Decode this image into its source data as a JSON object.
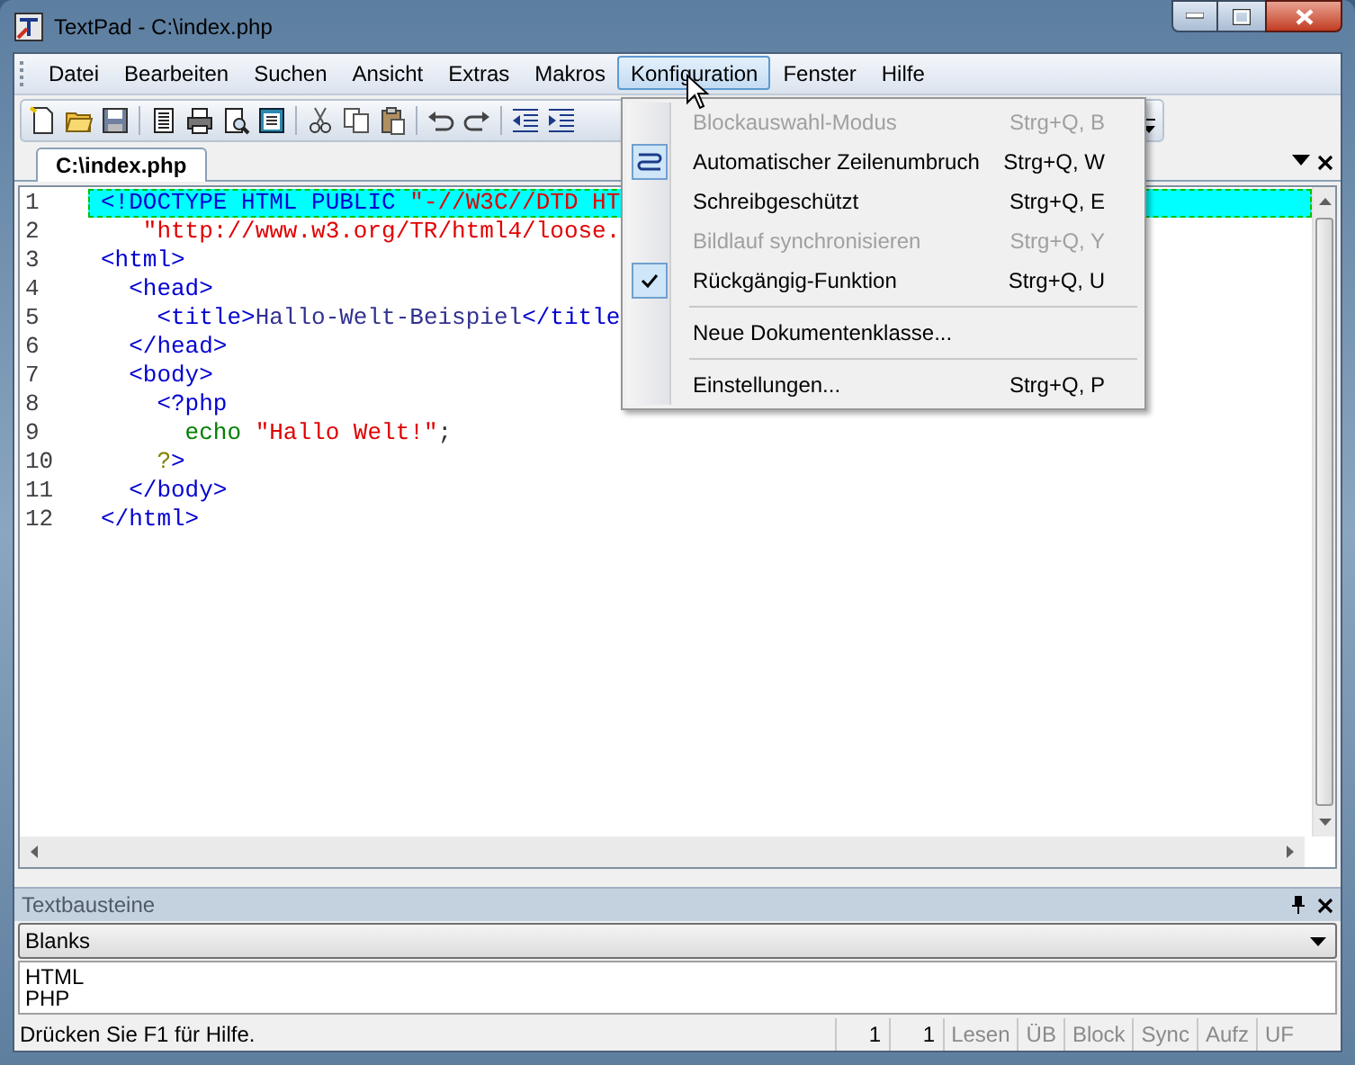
{
  "window": {
    "title": "TextPad - C:\\index.php"
  },
  "menu_bar": [
    {
      "label": "Datei",
      "selected": false
    },
    {
      "label": "Bearbeiten",
      "selected": false
    },
    {
      "label": "Suchen",
      "selected": false
    },
    {
      "label": "Ansicht",
      "selected": false
    },
    {
      "label": "Extras",
      "selected": false
    },
    {
      "label": "Makros",
      "selected": false
    },
    {
      "label": "Konfiguration",
      "selected": true
    },
    {
      "label": "Fenster",
      "selected": false
    },
    {
      "label": "Hilfe",
      "selected": false
    }
  ],
  "tabs": [
    {
      "label": "C:\\index.php",
      "selected": true
    }
  ],
  "editor": {
    "lines": [
      {
        "number": "1",
        "highlighted": true,
        "segments": [
          {
            "kind": "tag",
            "text": "<!DOCTYPE HTML PUBLIC "
          },
          {
            "kind": "string",
            "text": "\"-//W3C//DTD HT"
          }
        ]
      },
      {
        "number": "2",
        "highlighted": false,
        "segments": [
          {
            "kind": "string",
            "text": "   \"http://www.w3.org/TR/html4/loose."
          }
        ]
      },
      {
        "number": "3",
        "highlighted": false,
        "segments": [
          {
            "kind": "tag",
            "text": "<html>"
          }
        ]
      },
      {
        "number": "4",
        "highlighted": false,
        "segments": [
          {
            "kind": "tag",
            "text": "  <head>"
          }
        ]
      },
      {
        "number": "5",
        "highlighted": false,
        "segments": [
          {
            "kind": "tag",
            "text": "    <title>"
          },
          {
            "kind": "text",
            "text": "Hallo-Welt-Beispiel"
          },
          {
            "kind": "tag",
            "text": "</title"
          }
        ]
      },
      {
        "number": "6",
        "highlighted": false,
        "segments": [
          {
            "kind": "tag",
            "text": "  </head>"
          }
        ]
      },
      {
        "number": "7",
        "highlighted": false,
        "segments": [
          {
            "kind": "tag",
            "text": "  <body>"
          }
        ]
      },
      {
        "number": "8",
        "highlighted": false,
        "segments": [
          {
            "kind": "tag",
            "text": "    <?php"
          }
        ]
      },
      {
        "number": "9",
        "highlighted": false,
        "segments": [
          {
            "kind": "keyword",
            "text": "      echo "
          },
          {
            "kind": "string",
            "text": "\"Hallo Welt!\""
          },
          {
            "kind": "plain",
            "text": ";"
          }
        ]
      },
      {
        "number": "10",
        "highlighted": false,
        "segments": [
          {
            "kind": "php",
            "text": "    ?"
          },
          {
            "kind": "tag",
            "text": ">"
          }
        ]
      },
      {
        "number": "11",
        "highlighted": false,
        "segments": [
          {
            "kind": "tag",
            "text": "  </body>"
          }
        ]
      },
      {
        "number": "12",
        "highlighted": false,
        "segments": [
          {
            "kind": "tag",
            "text": "</html>"
          }
        ]
      }
    ]
  },
  "dropdown_menu": {
    "items": [
      {
        "kind": "item",
        "label": "Blockauswahl-Modus",
        "shortcut": "Strg+Q, B",
        "disabled": true,
        "checked": false
      },
      {
        "kind": "icon",
        "label": "Automatischer Zeilenumbruch",
        "shortcut": "Strg+Q, W",
        "disabled": false,
        "checked": false
      },
      {
        "kind": "item",
        "label": "Schreibgeschützt",
        "shortcut": "Strg+Q, E",
        "disabled": false,
        "checked": false
      },
      {
        "kind": "item",
        "label": "Bildlauf synchronisieren",
        "shortcut": "Strg+Q, Y",
        "disabled": true,
        "checked": false
      },
      {
        "kind": "item",
        "label": "Rückgängig-Funktion",
        "shortcut": "Strg+Q, U",
        "disabled": false,
        "checked": true
      },
      {
        "kind": "separator"
      },
      {
        "kind": "item",
        "label": "Neue Dokumentenklasse...",
        "disabled": false,
        "checked": false
      },
      {
        "kind": "separator"
      },
      {
        "kind": "item",
        "label": "Einstellungen...",
        "shortcut": "Strg+Q, P",
        "disabled": false,
        "checked": false
      }
    ]
  },
  "panel": {
    "title": "Textbausteine",
    "dropdown": {
      "value": "Blanks"
    },
    "items": [
      {
        "label": "HTML"
      },
      {
        "label": "PHP"
      }
    ]
  },
  "status_bar": {
    "message": "Drücken Sie F1 für Hilfe.",
    "fields": [
      {
        "text": "1",
        "disabled": false
      },
      {
        "text": "1",
        "disabled": false
      },
      {
        "text": "Lesen",
        "disabled": true
      },
      {
        "text": "ÜB",
        "disabled": true
      },
      {
        "text": "Block",
        "disabled": true
      },
      {
        "text": "Sync",
        "disabled": true
      },
      {
        "text": "Aufz",
        "disabled": true
      },
      {
        "text": "UF",
        "disabled": true
      }
    ]
  }
}
